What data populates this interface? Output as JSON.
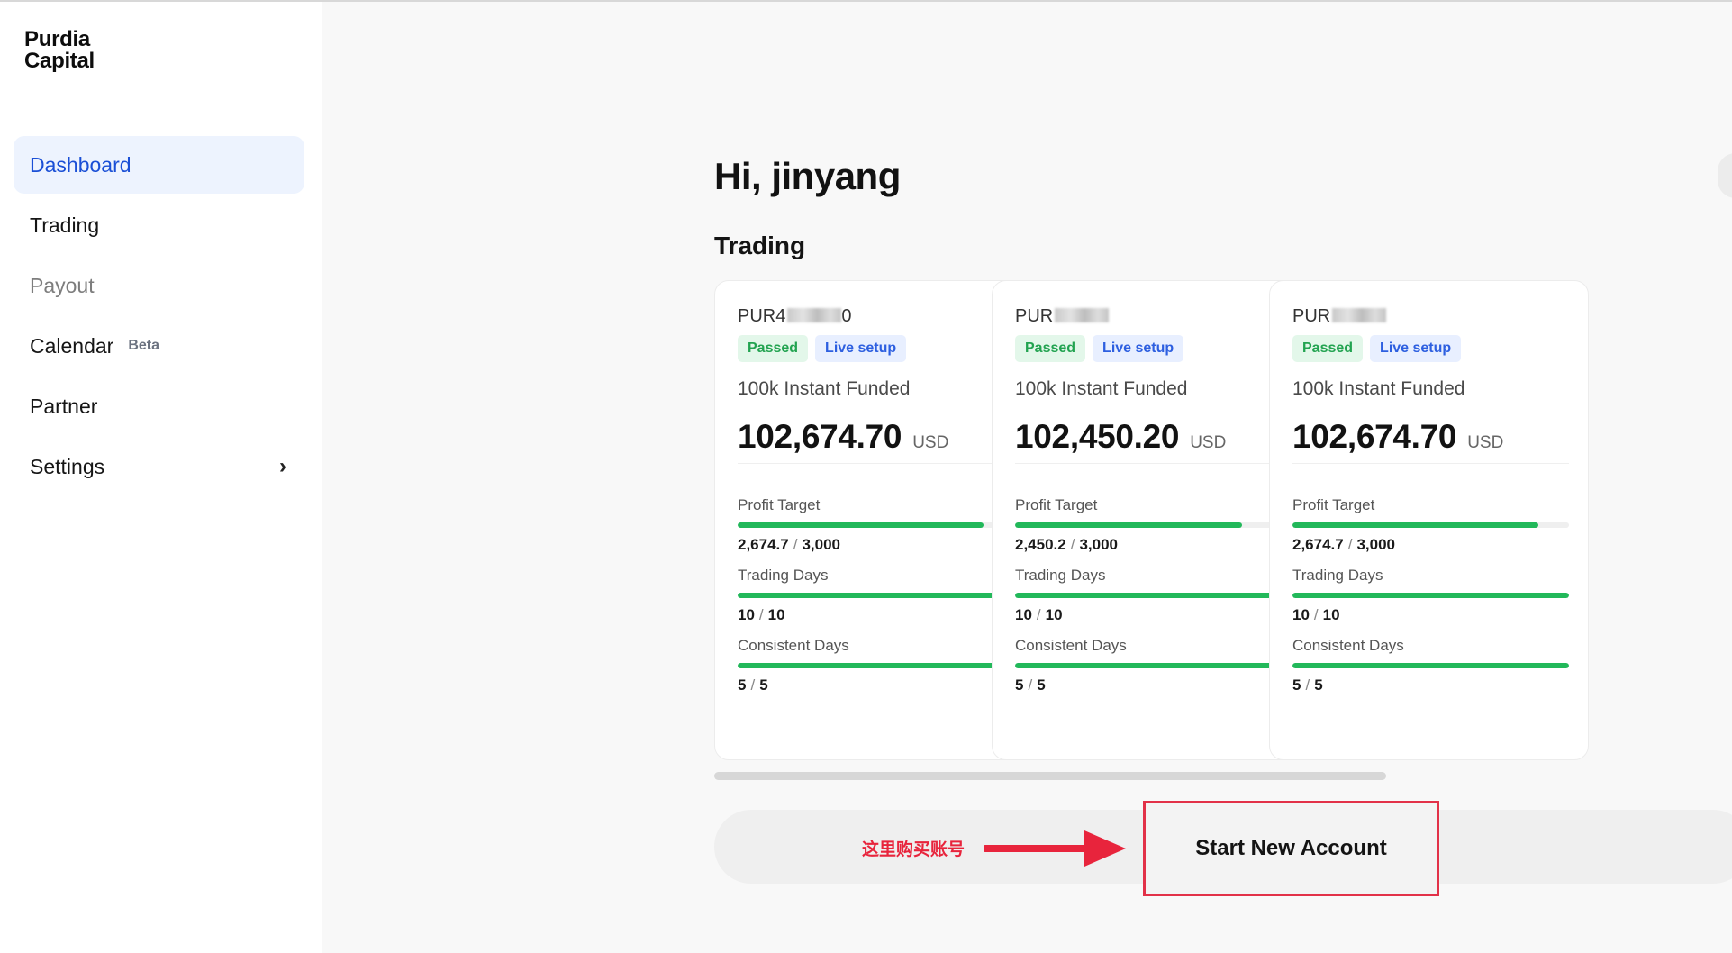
{
  "brand": {
    "line1": "Purdia",
    "line2": "Capital"
  },
  "sidebar": {
    "items": [
      {
        "label": "Dashboard"
      },
      {
        "label": "Trading"
      },
      {
        "label": "Payout"
      },
      {
        "label": "Calendar",
        "badge": "Beta"
      },
      {
        "label": "Partner"
      },
      {
        "label": "Settings",
        "chevron": "›"
      }
    ]
  },
  "main": {
    "greeting": "Hi, jinyang",
    "section_title": "Trading",
    "accounts": [
      {
        "id_prefix": "PUR4",
        "id_suffix": "0",
        "tags": [
          "Passed",
          "Live setup"
        ],
        "plan": "100k Instant Funded",
        "balance": "102,674.70",
        "currency": "USD",
        "metrics": [
          {
            "label": "Profit Target",
            "current": "2,674.7",
            "target": "3,000",
            "progress": 0.89
          },
          {
            "label": "Trading Days",
            "current": "10",
            "target": "10",
            "progress": 1.0
          },
          {
            "label": "Consistent Days",
            "current": "5",
            "target": "5",
            "progress": 1.0
          }
        ]
      },
      {
        "id_prefix": "PUR",
        "id_suffix": "",
        "tags": [
          "Passed",
          "Live setup"
        ],
        "plan": "100k Instant Funded",
        "balance": "102,450.20",
        "currency": "USD",
        "metrics": [
          {
            "label": "Profit Target",
            "current": "2,450.2",
            "target": "3,000",
            "progress": 0.82
          },
          {
            "label": "Trading Days",
            "current": "10",
            "target": "10",
            "progress": 1.0
          },
          {
            "label": "Consistent Days",
            "current": "5",
            "target": "5",
            "progress": 1.0
          }
        ]
      },
      {
        "id_prefix": "PUR",
        "id_suffix": "",
        "tags": [
          "Passed",
          "Live setup"
        ],
        "plan": "100k Instant Funded",
        "balance": "102,674.70",
        "currency": "USD",
        "metrics": [
          {
            "label": "Profit Target",
            "current": "2,674.7",
            "target": "3,000",
            "progress": 0.89
          },
          {
            "label": "Trading Days",
            "current": "10",
            "target": "10",
            "progress": 1.0
          },
          {
            "label": "Consistent Days",
            "current": "5",
            "target": "5",
            "progress": 1.0
          }
        ]
      }
    ],
    "separator": "/",
    "annotation": "这里购买账号",
    "start_button": "Start New Account"
  },
  "colors": {
    "accent": "#1a4fd6",
    "passed": "#22a350",
    "live": "#2d5fe0",
    "progress": "#22b85a",
    "annotation": "#e8243c"
  }
}
